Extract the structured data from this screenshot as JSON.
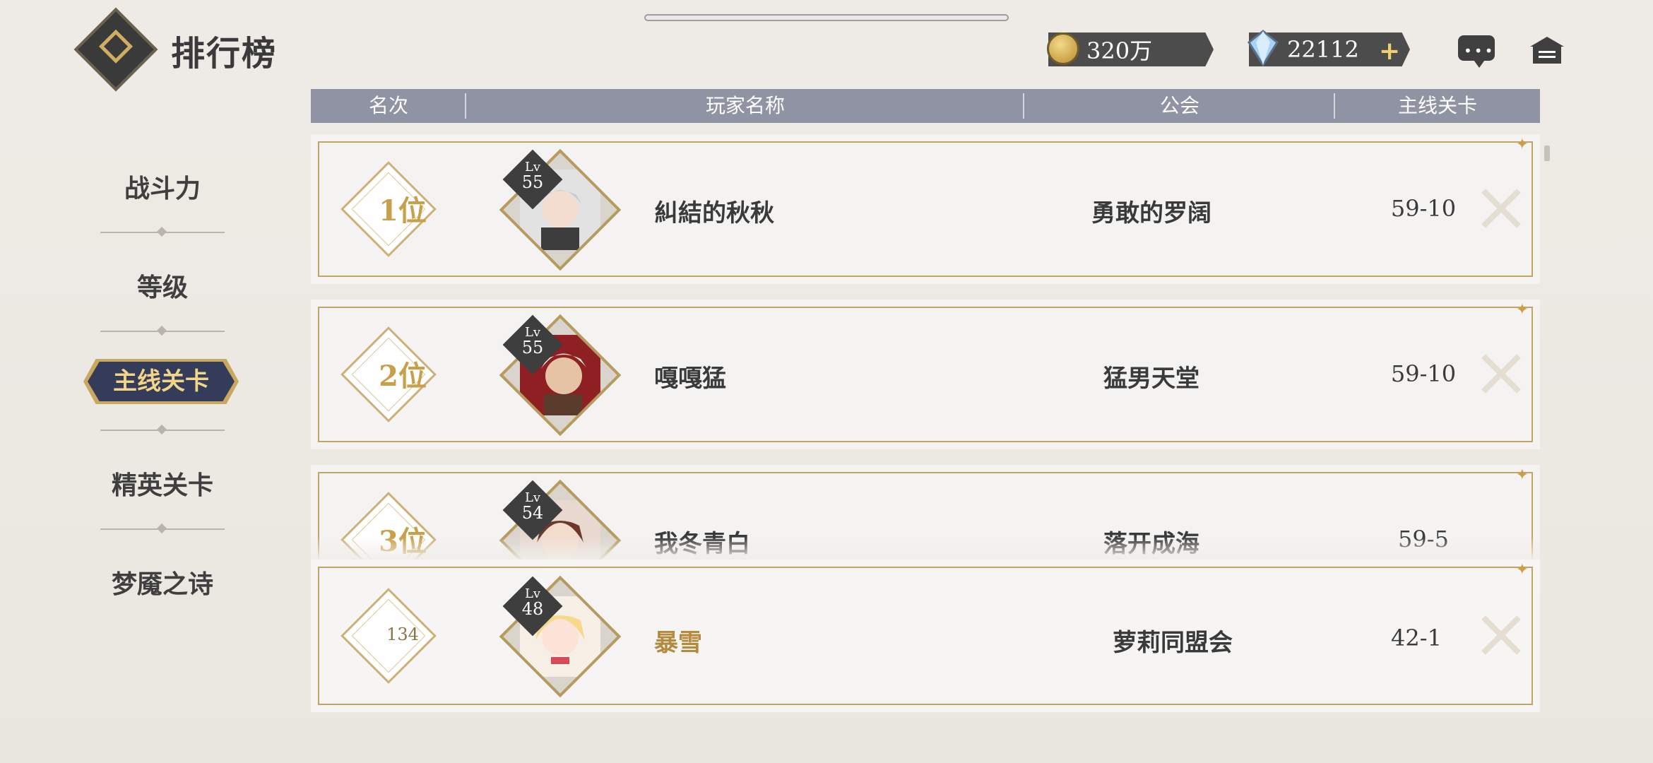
{
  "header": {
    "title": "排行榜"
  },
  "currency": {
    "coins": "320万",
    "gems": "22112"
  },
  "sidebar": {
    "items": [
      {
        "label": "战斗力"
      },
      {
        "label": "等级"
      },
      {
        "label": "主线关卡",
        "active": true
      },
      {
        "label": "精英关卡"
      },
      {
        "label": "梦魇之诗"
      }
    ]
  },
  "table": {
    "columns": [
      "名次",
      "玩家名称",
      "公会",
      "主线关卡"
    ],
    "rows": [
      {
        "rank": "1位",
        "level_label": "Lv",
        "level": "55",
        "name": "糾結的秋秋",
        "guild": "勇敢的罗阔",
        "stage": "59-10"
      },
      {
        "rank": "2位",
        "level_label": "Lv",
        "level": "55",
        "name": "嘎嘎猛",
        "guild": "猛男天堂",
        "stage": "59-10"
      },
      {
        "rank": "3位",
        "level_label": "Lv",
        "level": "54",
        "name": "我冬青白",
        "guild": "落开成海",
        "stage": "59-5"
      }
    ],
    "self_row": {
      "rank": "134",
      "level_label": "Lv",
      "level": "48",
      "name": "暴雪",
      "guild": "萝莉同盟会",
      "stage": "42-1"
    }
  },
  "colors": {
    "accent_gold": "#c9a04a",
    "header_bar": "#8f93a3",
    "active_tab": "#343c59",
    "self_name": "#b48a3c"
  }
}
